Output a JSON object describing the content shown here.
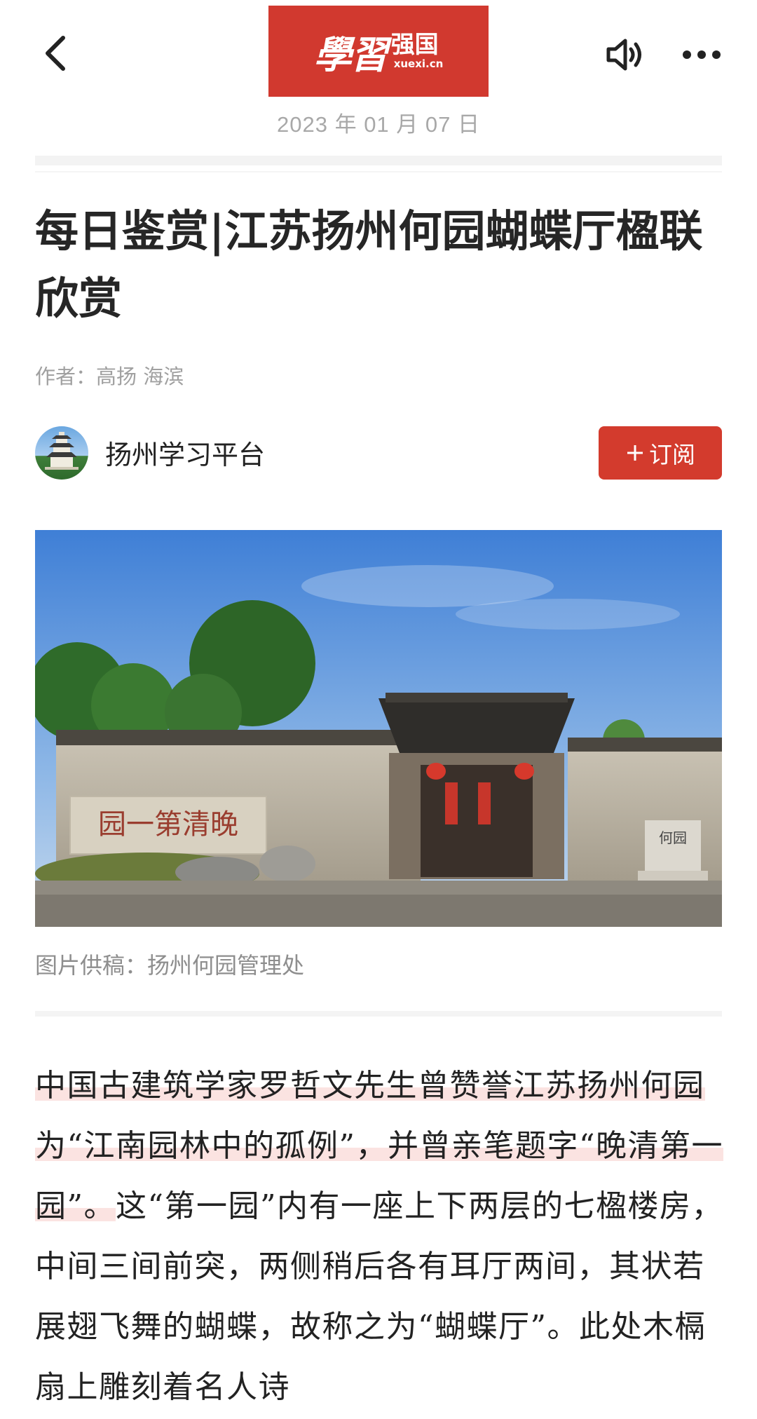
{
  "header": {
    "logo_script": "學習",
    "logo_name": "强国",
    "logo_domain": "xuexi.cn",
    "icons": {
      "back": "chevron-left-icon",
      "speaker": "speaker-icon",
      "more": "more-dots-icon"
    }
  },
  "article": {
    "date": "2023 年 01 月 07 日",
    "title": "每日鉴赏|江苏扬州何园蝴蝶厅楹联欣赏",
    "author": "作者：高扬 海滨",
    "source_name": "扬州学习平台",
    "subscribe_label": "订阅",
    "subscribe_icon": "plus-icon",
    "image_caption": "图片供稿：扬州何园管理处",
    "photo": {
      "wall_inscription": "园一第清晚",
      "stone_label": "何园"
    },
    "body": {
      "highlighted": "中国古建筑学家罗哲文先生曾赞誉江苏扬州何园为“江南园林中的孤例”，并曾亲笔题字“晚清第一园”。",
      "rest": "这“第一园”内有一座上下两层的七楹楼房，中间三间前突，两侧稍后各有耳厅两间，其状若展翅飞舞的蝴蝶，故称之为“蝴蝶厅”。此处木槅扇上雕刻着名人诗"
    }
  },
  "colors": {
    "brand_red": "#d1392f",
    "subscribe_red": "#d33b2d",
    "highlight": "#fbe3e1",
    "muted_text": "#a0a0a0"
  }
}
